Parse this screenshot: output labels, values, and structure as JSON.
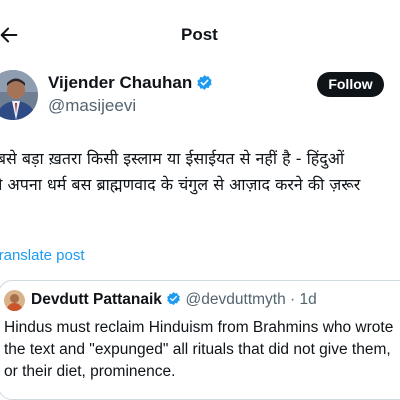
{
  "header": {
    "title": "Post",
    "back_icon": "back-arrow-icon"
  },
  "post": {
    "author_name": "Vijender Chauhan",
    "author_handle": "@masijeevi",
    "verified_icon": "verified-badge-icon",
    "follow_label": "Follow",
    "text_lines": [
      "सबसे बड़ा ख़तरा किसी इस्लाम या ईसाईयत से नहीं है - हिंदुओं",
      "को अपना धर्म बस ब्राह्मणवाद के चंगुल से आज़ाद करने की ज़रूर",
      "।"
    ],
    "translate_label": "Translate post"
  },
  "quote": {
    "author_name": "Devdutt Pattanaik",
    "author_handle": "@devduttmyth",
    "separator": "·",
    "time": "1d",
    "text": "Hindus must reclaim Hinduism from Brahmins who wrote the text and \"expunged\" all rituals that did not give them, or their diet, prominence."
  },
  "colors": {
    "accent": "#1d9bf0",
    "text": "#0f1419",
    "secondary_text": "#536471",
    "follow_bg": "#0f1419",
    "border": "#cfd9de"
  }
}
